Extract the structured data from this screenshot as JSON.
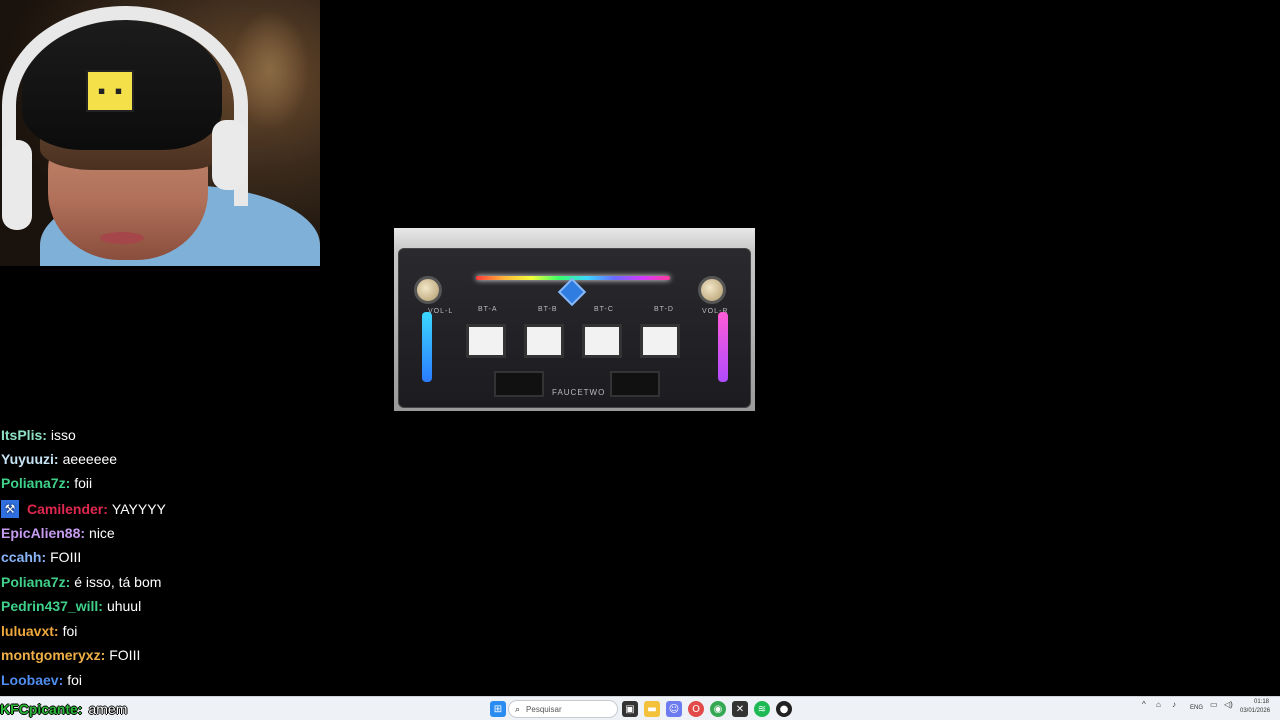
{
  "chat": {
    "messages": [
      {
        "user": "ItsPlis:",
        "text": "isso",
        "color": "#8fe0c6"
      },
      {
        "user": "Yuyuuzi:",
        "text": "aeeeeee",
        "color": "#c8e4f4"
      },
      {
        "user": "Poliana7z:",
        "text": "foii",
        "color": "#3fd18a"
      },
      {
        "user": "Camilender:",
        "text": "YAYYYY",
        "color": "#e0284f",
        "badge": true
      },
      {
        "user": "EpicAlien88:",
        "text": "nice",
        "color": "#c79cf0"
      },
      {
        "user": "ccahh:",
        "text": "FOIII",
        "color": "#8ab4f8"
      },
      {
        "user": "Poliana7z:",
        "text": "é isso, tá bom",
        "color": "#3fd18a"
      },
      {
        "user": "Pedrin437_will:",
        "text": "uhuul",
        "color": "#3fd18a"
      },
      {
        "user": "luluavxt:",
        "text": "foi",
        "color": "#f0a83c"
      },
      {
        "user": "montgomeryxz:",
        "text": "FOIII",
        "color": "#f0b048"
      },
      {
        "user": "Loobaev:",
        "text": "foi",
        "color": "#4f8ef0"
      }
    ],
    "last": {
      "user": "KFCpicante:",
      "text": "amem"
    }
  },
  "product": {
    "brand": "FAUCETWO",
    "labels": [
      "VOL-L",
      "BT-A",
      "BT-B",
      "BT-C",
      "BT-D",
      "VOL-R"
    ]
  },
  "taskbar": {
    "search_placeholder": "Pesquisar",
    "language": "ENG",
    "time": "01:18",
    "date": "03/01/2026"
  }
}
